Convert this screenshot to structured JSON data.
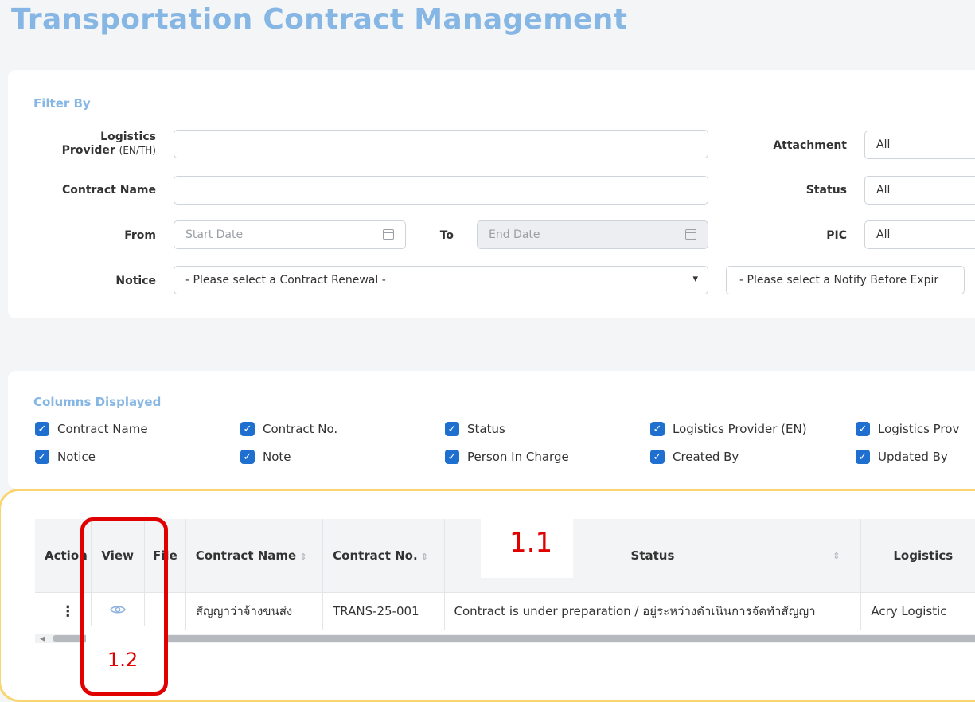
{
  "title": "Transportation Contract Management",
  "filter": {
    "section_title": "Filter By",
    "logistics_provider": {
      "label": "Logistics",
      "label2": "Provider",
      "label_suffix": "(EN/TH)",
      "value": ""
    },
    "contract_name": {
      "label": "Contract Name",
      "value": ""
    },
    "from": {
      "label": "From",
      "placeholder": "Start Date"
    },
    "to": {
      "label": "To",
      "placeholder": "End Date"
    },
    "notice": {
      "label": "Notice",
      "value": "- Please select a Contract Renewal -"
    },
    "notify_before": {
      "value": "- Please select a Notify Before Expir"
    },
    "attachment": {
      "label": "Attachment",
      "value": "All"
    },
    "status": {
      "label": "Status",
      "value": "All"
    },
    "pic": {
      "label": "PIC",
      "value": "All"
    }
  },
  "columns_displayed": {
    "section_title": "Columns Displayed",
    "items": [
      {
        "label": "Contract Name",
        "checked": true
      },
      {
        "label": "Contract No.",
        "checked": true
      },
      {
        "label": "Status",
        "checked": true
      },
      {
        "label": "Logistics Provider (EN)",
        "checked": true
      },
      {
        "label": "Logistics Prov",
        "checked": true
      },
      {
        "label": "Notice",
        "checked": true
      },
      {
        "label": "Note",
        "checked": true
      },
      {
        "label": "Person In Charge",
        "checked": true
      },
      {
        "label": "Created By",
        "checked": true
      },
      {
        "label": "Updated By",
        "checked": true
      }
    ]
  },
  "table": {
    "headers": {
      "action": "Action",
      "view": "View",
      "file": "File",
      "contract_name": "Contract Name",
      "contract_no": "Contract No.",
      "status": "Status",
      "logistics": "Logistics"
    },
    "rows": [
      {
        "action": "⋮",
        "contract_name": "สัญญาว่าจ้างขนส่ง",
        "contract_no": "TRANS-25-001",
        "status": "Contract is under preparation / อยู่ระหว่างดำเนินการจัดทำสัญญา",
        "logistics": "Acry Logistic"
      }
    ]
  },
  "annotations": {
    "a1": "1.1",
    "a2": "1.2"
  },
  "colors": {
    "title": "#86b6e3",
    "checkbox": "#1f6fd0",
    "annotation": "#e00000",
    "highlight": "#f8d56f"
  }
}
